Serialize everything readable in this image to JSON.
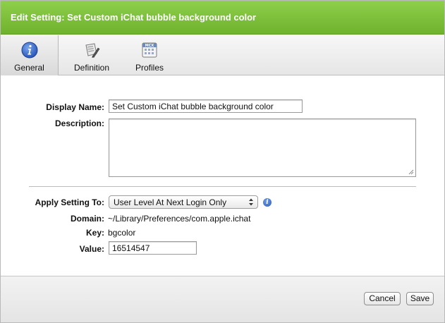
{
  "window": {
    "title": "Edit Setting: Set Custom iChat bubble background color"
  },
  "tabs": [
    {
      "label": "General",
      "icon": "info-icon",
      "active": true
    },
    {
      "label": "Definition",
      "icon": "definition-icon",
      "active": false
    },
    {
      "label": "Profiles",
      "icon": "mcx-profiles-icon",
      "active": false
    }
  ],
  "tab_icon_badge": "MCX",
  "form": {
    "display_name_label": "Display Name:",
    "display_name_value": "Set Custom iChat bubble background color",
    "description_label": "Description:",
    "description_value": "",
    "apply_label": "Apply Setting To:",
    "apply_value": "User Level At Next Login Only",
    "domain_label": "Domain:",
    "domain_value": "~/Library/Preferences/com.apple.ichat",
    "key_label": "Key:",
    "key_value": "bgcolor",
    "value_label": "Value:",
    "value_value": "16514547"
  },
  "footer": {
    "cancel_label": "Cancel",
    "save_label": "Save"
  },
  "colors": {
    "title_bar": "#7cbf37",
    "info_icon": "#2c5dbf"
  }
}
